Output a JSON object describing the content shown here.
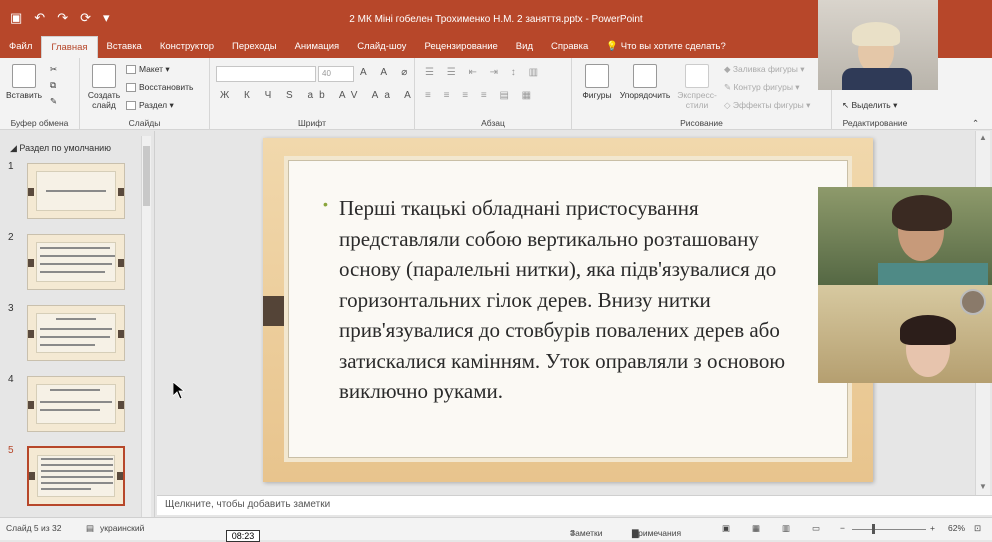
{
  "titlebar": {
    "title": "2 МК Міні гобелен Трохименко Н.М. 2 заняття.pptx  -  PowerPoint"
  },
  "tabs": [
    "Файл",
    "Главная",
    "Вставка",
    "Конструктор",
    "Переходы",
    "Анимация",
    "Слайд-шоу",
    "Рецензирование",
    "Вид",
    "Справка",
    "Что вы хотите сделать?"
  ],
  "ribbon": {
    "clipboard": {
      "paste": "Вставить",
      "label": "Буфер обмена"
    },
    "slides": {
      "create": "Создать слайд",
      "layout": "Макет",
      "reset": "Восстановить",
      "section": "Раздел",
      "label": "Слайды"
    },
    "font": {
      "size": "40",
      "label": "Шрифт"
    },
    "paragraph": {
      "label": "Абзац"
    },
    "drawing": {
      "shapes": "Фигуры",
      "arrange": "Упорядочить",
      "quick": "Экспресс-стили",
      "fill": "Заливка фигуры",
      "outline": "Контур фигуры",
      "effects": "Эффекты фигуры",
      "label": "Рисование"
    },
    "editing": {
      "select": "Выделить",
      "label": "Редактирование"
    }
  },
  "leftpane": {
    "section": "Раздел по умолчанию",
    "thumbs": [
      "1",
      "2",
      "3",
      "4",
      "5"
    ]
  },
  "slide": {
    "bullet": "Перші ткацькі обладнані пристосування представляли собою вертикально розташовану основу (паралельні нитки), яка підв'язувалися до горизонтальних гілок дерев. Внизу нитки прив'язувалися до стовбурів повалених дерев або затискалися камінням. Уток оправляли з основою виключно руками."
  },
  "notes": {
    "placeholder": "Щелкните, чтобы добавить заметки"
  },
  "status": {
    "slide": "Слайд 5 из 32",
    "lang": "украинский",
    "notes": "Заметки",
    "comments": "Примечания",
    "zoom": "62%",
    "time": "08:23"
  }
}
